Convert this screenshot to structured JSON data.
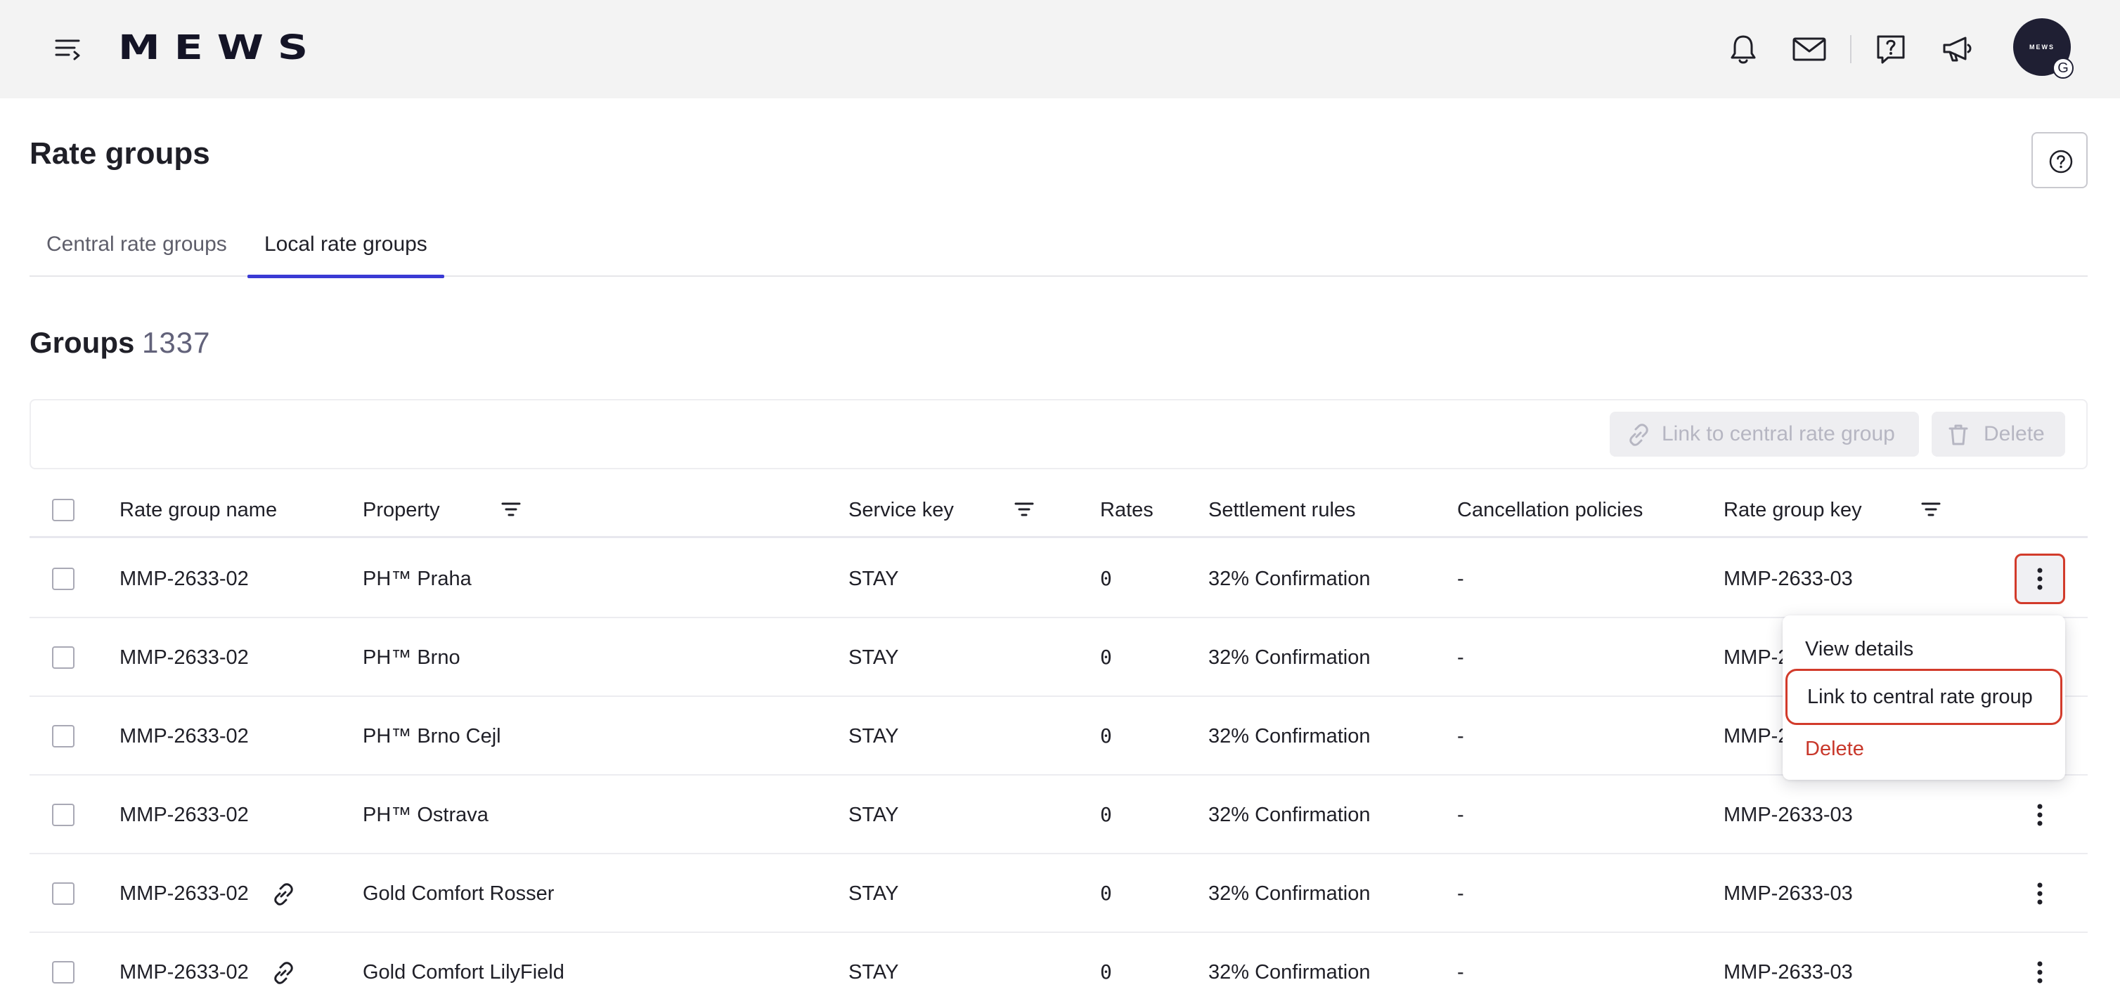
{
  "app": {
    "logo_text": "MEWS",
    "avatar_logo": "MEWS",
    "avatar_badge": "G"
  },
  "topbar": {
    "icons": [
      "menu-icon",
      "bell-icon",
      "mail-icon",
      "help-chat-icon",
      "megaphone-icon"
    ]
  },
  "page": {
    "title": "Rate groups"
  },
  "tabs": [
    {
      "label": "Central rate groups",
      "active": false
    },
    {
      "label": "Local rate groups",
      "active": true
    }
  ],
  "groups": {
    "title": "Groups",
    "count": "1337"
  },
  "toolbar": {
    "link_label": "Link to central rate group",
    "delete_label": "Delete"
  },
  "table": {
    "headers": {
      "name": "Rate group name",
      "property": "Property",
      "service_key": "Service key",
      "rates": "Rates",
      "settlement": "Settlement rules",
      "cancellation": "Cancellation policies",
      "key": "Rate group key"
    },
    "rows": [
      {
        "name": "MMP-2633-02",
        "linked": false,
        "property": "PH™ Praha",
        "service_key": "STAY",
        "rates": "0",
        "settlement": "32% Confirmation",
        "cancellation": "-",
        "key": "MMP-2633-03"
      },
      {
        "name": "MMP-2633-02",
        "linked": false,
        "property": "PH™ Brno",
        "service_key": "STAY",
        "rates": "0",
        "settlement": "32% Confirmation",
        "cancellation": "-",
        "key": "MMP-2633-03"
      },
      {
        "name": "MMP-2633-02",
        "linked": false,
        "property": "PH™ Brno Cejl",
        "service_key": "STAY",
        "rates": "0",
        "settlement": "32% Confirmation",
        "cancellation": "-",
        "key": "MMP-2633-03"
      },
      {
        "name": "MMP-2633-02",
        "linked": false,
        "property": "PH™ Ostrava",
        "service_key": "STAY",
        "rates": "0",
        "settlement": "32% Confirmation",
        "cancellation": "-",
        "key": "MMP-2633-03"
      },
      {
        "name": "MMP-2633-02",
        "linked": true,
        "property": "Gold Comfort Rosser",
        "service_key": "STAY",
        "rates": "0",
        "settlement": "32% Confirmation",
        "cancellation": "-",
        "key": "MMP-2633-03"
      },
      {
        "name": "MMP-2633-02",
        "linked": true,
        "property": "Gold Comfort LilyField",
        "service_key": "STAY",
        "rates": "0",
        "settlement": "32% Confirmation",
        "cancellation": "-",
        "key": "MMP-2633-03"
      }
    ]
  },
  "dropdown": {
    "items": [
      "View details",
      "Link to central rate group",
      "Delete"
    ]
  },
  "colors": {
    "accent": "#3a3ad4",
    "danger": "#c8372a",
    "highlight_border": "#d23b2b",
    "topbar_bg": "#f3f3f3"
  }
}
